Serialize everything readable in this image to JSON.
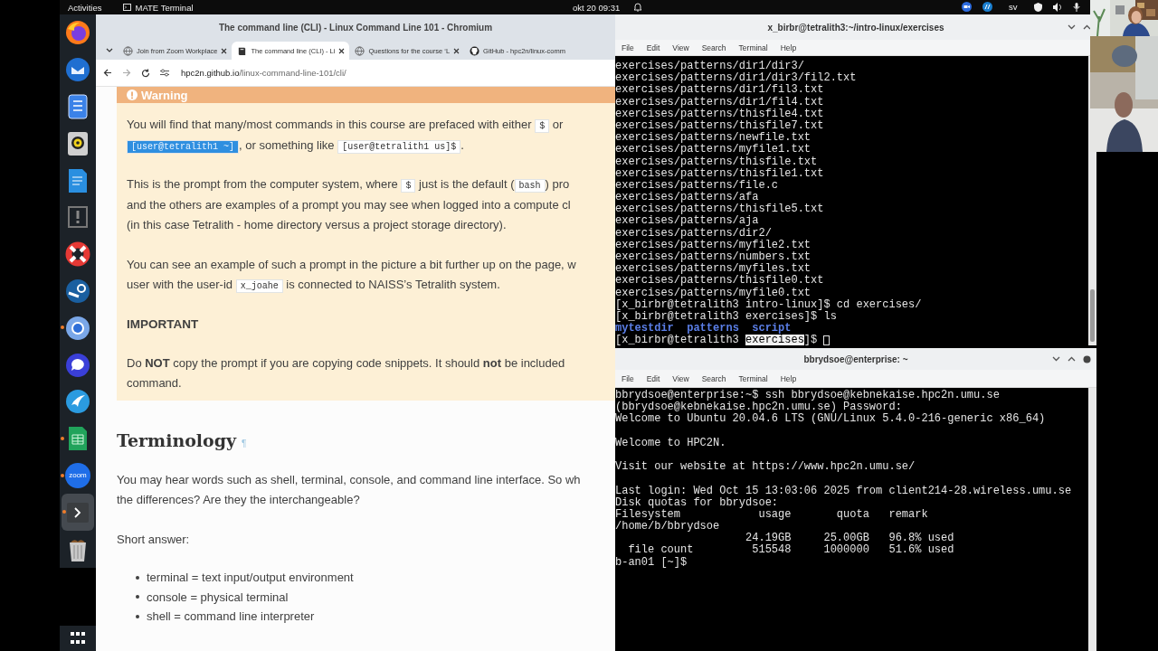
{
  "top_bar": {
    "activities": "Activities",
    "app_name": "MATE Terminal",
    "clock": "okt 20 09:31",
    "language": "sv"
  },
  "dock": {
    "items": [
      {
        "running": false,
        "active": false
      },
      {
        "running": false,
        "active": false
      },
      {
        "running": false,
        "active": false
      },
      {
        "running": false,
        "active": false
      },
      {
        "running": false,
        "active": false
      },
      {
        "running": false,
        "active": false
      },
      {
        "running": false,
        "active": false
      },
      {
        "running": false,
        "active": false
      },
      {
        "running": true,
        "active": false
      },
      {
        "running": false,
        "active": false
      },
      {
        "running": false,
        "active": false
      },
      {
        "running": true,
        "active": false
      },
      {
        "running": true,
        "active": false,
        "label": "zoom"
      },
      {
        "running": true,
        "active": true
      },
      {
        "running": false,
        "active": false
      }
    ]
  },
  "browser": {
    "title": "The command line (CLI) - Linux Command Line 101 - Chromium",
    "tabs": [
      {
        "label": "Join from Zoom Workplace",
        "selected": false
      },
      {
        "label": "The command line (CLI) - Li",
        "selected": true
      },
      {
        "label": "Questions for the course ‘L",
        "selected": false
      },
      {
        "label": "GitHub - hpc2n/linux-comm",
        "selected": false
      }
    ],
    "url_host": "hpc2n.github.io",
    "url_path": "/linux-command-line-101/cli/",
    "warning": {
      "title": "Warning",
      "blocks": [
        {
          "kind": "paragraph",
          "lines": [
            [
              {
                "kind": "text",
                "text": "You will find that many/most commands in this course are prefaced with either "
              },
              {
                "kind": "code",
                "text": "$",
                "selected": false
              },
              {
                "kind": "text",
                "text": " or"
              }
            ],
            [
              {
                "kind": "code",
                "text": "[user@tetralith1 ~]",
                "selected": true
              },
              {
                "kind": "text",
                "text": ", or something like "
              },
              {
                "kind": "code",
                "text": "[user@tetralith1 us]$",
                "selected": false
              },
              {
                "kind": "text",
                "text": "."
              }
            ]
          ]
        },
        {
          "kind": "paragraph",
          "lines": [
            [
              {
                "kind": "text",
                "text": "This is the prompt from the computer system, where "
              },
              {
                "kind": "code",
                "text": "$",
                "selected": false
              },
              {
                "kind": "text",
                "text": " just is the default ("
              },
              {
                "kind": "code",
                "text": "bash",
                "selected": false
              },
              {
                "kind": "text",
                "text": ") pro"
              }
            ],
            [
              {
                "kind": "text",
                "text": "and the others are examples of a prompt you may see when logged into a compute cl"
              }
            ],
            [
              {
                "kind": "text",
                "text": "(in this case Tetralith - home directory versus a project storage directory)."
              }
            ]
          ]
        },
        {
          "kind": "paragraph",
          "lines": [
            [
              {
                "kind": "text",
                "text": "You can see an example of such a prompt in the picture a bit further up on the page, w"
              }
            ],
            [
              {
                "kind": "text",
                "text": "user with the user-id "
              },
              {
                "kind": "code",
                "text": "x_joahe",
                "selected": false
              },
              {
                "kind": "text",
                "text": " is connected to NAISS’s Tetralith system."
              }
            ]
          ]
        },
        {
          "kind": "subheading",
          "text": "IMPORTANT"
        },
        {
          "kind": "paragraph",
          "lines": [
            [
              {
                "kind": "text",
                "text": "Do **NOT** copy the prompt if you are copying code snippets. It should **not** be included"
              }
            ],
            [
              {
                "kind": "text",
                "text": "command."
              }
            ]
          ]
        }
      ]
    },
    "heading": "Terminology",
    "heading_mark": "¶",
    "paragraphs": [
      {
        "lines": [
          [
            {
              "kind": "text",
              "text": "You may hear words such as shell, terminal, console, and command line interface. So wh"
            }
          ],
          [
            {
              "kind": "text",
              "text": "the differences? Are they the interchangeable?"
            }
          ]
        ]
      },
      {
        "lines": [
          [
            {
              "kind": "text",
              "text": "Short answer:"
            }
          ]
        ]
      }
    ],
    "bullets": [
      "terminal = text input/output environment",
      "console = physical terminal",
      "shell = command line interpreter"
    ]
  },
  "terminals": [
    {
      "title": "x_birbr@tetralith3:~/intro-linux/exercises",
      "menu": [
        "File",
        "Edit",
        "View",
        "Search",
        "Terminal",
        "Help"
      ],
      "close_visible": false,
      "cursor": true,
      "blocks": [
        [
          "exercises/patterns/dir1/dir3/",
          "exercises/patterns/dir1/dir3/fil2.txt",
          "exercises/patterns/dir1/fil3.txt",
          "exercises/patterns/dir1/fil4.txt",
          "exercises/patterns/thisfile4.txt",
          "exercises/patterns/thisfile7.txt",
          "exercises/patterns/newfile.txt",
          "exercises/patterns/myfile1.txt",
          "exercises/patterns/thisfile.txt",
          "exercises/patterns/thisfile1.txt",
          "exercises/patterns/file.c",
          "exercises/patterns/afa",
          "exercises/patterns/thisfile5.txt",
          "exercises/patterns/aja",
          "exercises/patterns/dir2/",
          "exercises/patterns/myfile2.txt",
          "exercises/patterns/numbers.txt",
          "exercises/patterns/myfiles.txt",
          "exercises/patterns/thisfile0.txt",
          "exercises/patterns/myfile0.txt",
          "[x_birbr@tetralith3 intro-linux]$ cd exercises/",
          "[x_birbr@tetralith3 exercises]$ ls",
          [
            {
              "kind": "dir",
              "text": "mytestdir  "
            },
            {
              "kind": "dir",
              "text": "patterns  "
            },
            {
              "kind": "dir",
              "text": "script"
            }
          ],
          [
            {
              "kind": "plain",
              "text": "[x_birbr@tetralith3 "
            },
            {
              "kind": "selected",
              "text": "exercises"
            },
            {
              "kind": "plain",
              "text": "]$ "
            }
          ]
        ]
      ]
    },
    {
      "title": "bbrydsoe@enterprise: ~",
      "menu": [
        "File",
        "Edit",
        "View",
        "Search",
        "Terminal",
        "Help"
      ],
      "close_visible": true,
      "blocks": [
        [
          "bbrydsoe@enterprise:~$ ssh bbrydsoe@kebnekaise.hpc2n.umu.se",
          "(bbrydsoe@kebnekaise.hpc2n.umu.se) Password:",
          "Welcome to Ubuntu 20.04.6 LTS (GNU/Linux 5.4.0-216-generic x86_64)"
        ],
        [
          "Welcome to HPC2N."
        ],
        [
          "Visit our website at https://www.hpc2n.umu.se/"
        ],
        [
          "Last login: Wed Oct 15 13:03:06 2025 from client214-28.wireless.umu.se",
          "Disk quotas for bbrydsoe:",
          "Filesystem            usage       quota   remark",
          "/home/b/bbrydsoe",
          "                    24.19GB     25.00GB   96.8% used",
          "  file count         515548     1000000   51.6% used",
          "b-an01 [~]$"
        ]
      ]
    }
  ]
}
